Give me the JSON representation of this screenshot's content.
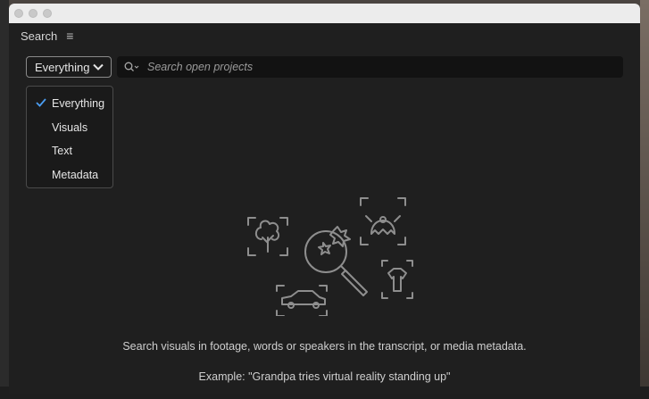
{
  "panel": {
    "title": "Search"
  },
  "search": {
    "scope_selected": "Everything",
    "placeholder": "Search open projects",
    "value": ""
  },
  "scope_menu": {
    "items": [
      {
        "label": "Everything",
        "checked": true
      },
      {
        "label": "Visuals",
        "checked": false
      },
      {
        "label": "Text",
        "checked": false
      },
      {
        "label": "Metadata",
        "checked": false
      }
    ]
  },
  "empty_state": {
    "description": "Search visuals in footage, words or speakers in the transcript, or media metadata.",
    "example": "Example: \"Grandpa tries virtual reality standing up\""
  },
  "colors": {
    "panel_bg": "#1f1f1f",
    "accent_check": "#4a9cf0",
    "text": "#d6d6d6"
  }
}
